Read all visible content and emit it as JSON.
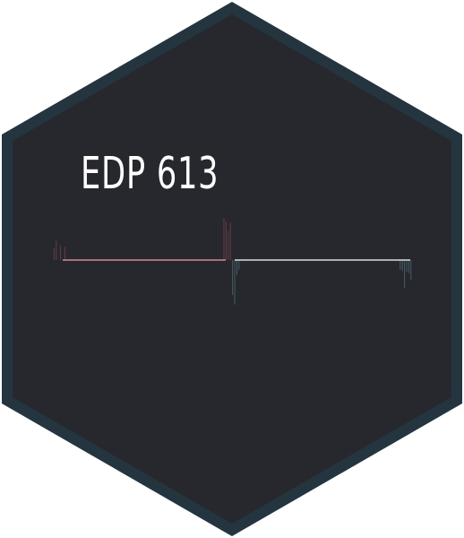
{
  "sticker": {
    "title": "EDP 613",
    "colors": {
      "border": "#243540",
      "fill": "#27282e",
      "bars_positive": "#5b8ea3",
      "bars_negative": "#b04860",
      "title": "#ffffff"
    }
  }
}
